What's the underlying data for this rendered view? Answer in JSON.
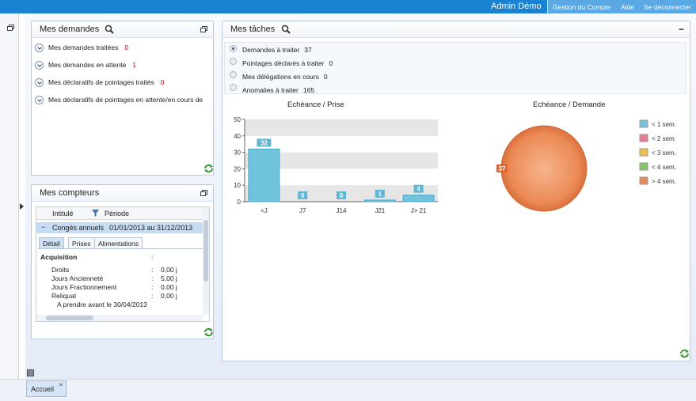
{
  "topbar": {
    "user": "Admin Démo",
    "account": "Gestion du Compte",
    "help": "Aide",
    "logout": "Se déconnecter"
  },
  "demandes": {
    "title": "Mes demandes",
    "items": [
      {
        "label": "Mes demandes traitées",
        "count": "0"
      },
      {
        "label": "Mes demandes en attente",
        "count": "1"
      },
      {
        "label": "Mes déclaratifs de pointages traités",
        "count": "0"
      },
      {
        "label": "Mes déclaratifs de pointages en attente/en cours de",
        "count": ""
      }
    ]
  },
  "compteurs": {
    "title": "Mes compteurs",
    "col_intitule": "Intitulé",
    "col_periode": "Période",
    "row_label": "Congés annuels",
    "row_periode": "01/01/2013  au  31/12/2013",
    "tabs": [
      "Détail",
      "Prises",
      "Alimentations"
    ],
    "section": "Acquisition",
    "section_sep": ":",
    "lines": [
      {
        "label": "Droits",
        "sep": ":",
        "value": "0,00 j"
      },
      {
        "label": "Jours Ancienneté",
        "sep": ":",
        "value": "5,00 j"
      },
      {
        "label": "Jours Fractionnement",
        "sep": ":",
        "value": "0,00 j"
      },
      {
        "label": "Reliquat",
        "sep": ":",
        "value": "0,00 j"
      }
    ],
    "note": "A prendre avant le 30/04/2013"
  },
  "taches": {
    "title": "Mes tâches",
    "collapse": "−",
    "items": [
      {
        "label": "Demandes à traiter",
        "count": "37"
      },
      {
        "label": "Pointages déclarés à traiter",
        "count": "0"
      },
      {
        "label": "Mes délégations en cours",
        "count": "0"
      },
      {
        "label": "Anomalies à traiter",
        "count": "165"
      }
    ]
  },
  "chart_data": [
    {
      "type": "bar",
      "title": "Echéance / Prise",
      "categories": [
        "<J",
        "J7",
        "J14",
        "J21",
        "J> 21"
      ],
      "values": [
        32,
        0,
        0,
        1,
        4
      ],
      "ylim": [
        0,
        50
      ],
      "yticks": [
        0,
        10,
        20,
        30,
        40,
        50
      ],
      "color": "#6fc3dc"
    },
    {
      "type": "pie",
      "title": "Echéance / Demande",
      "slices": [
        {
          "label": "< 1 sem.",
          "value": 0,
          "color": "#6fc3dc"
        },
        {
          "label": "< 2 sem.",
          "value": 0,
          "color": "#e87a8e"
        },
        {
          "label": "< 3 sem.",
          "value": 0,
          "color": "#f2c04a"
        },
        {
          "label": "< 4 sem.",
          "value": 0,
          "color": "#7fc86a"
        },
        {
          "label": "> 4 sem.",
          "value": 37,
          "color": "#ec8a55"
        }
      ],
      "data_label": "37"
    }
  ],
  "footer": {
    "tab": "Accueil",
    "tab_close": "✕"
  }
}
